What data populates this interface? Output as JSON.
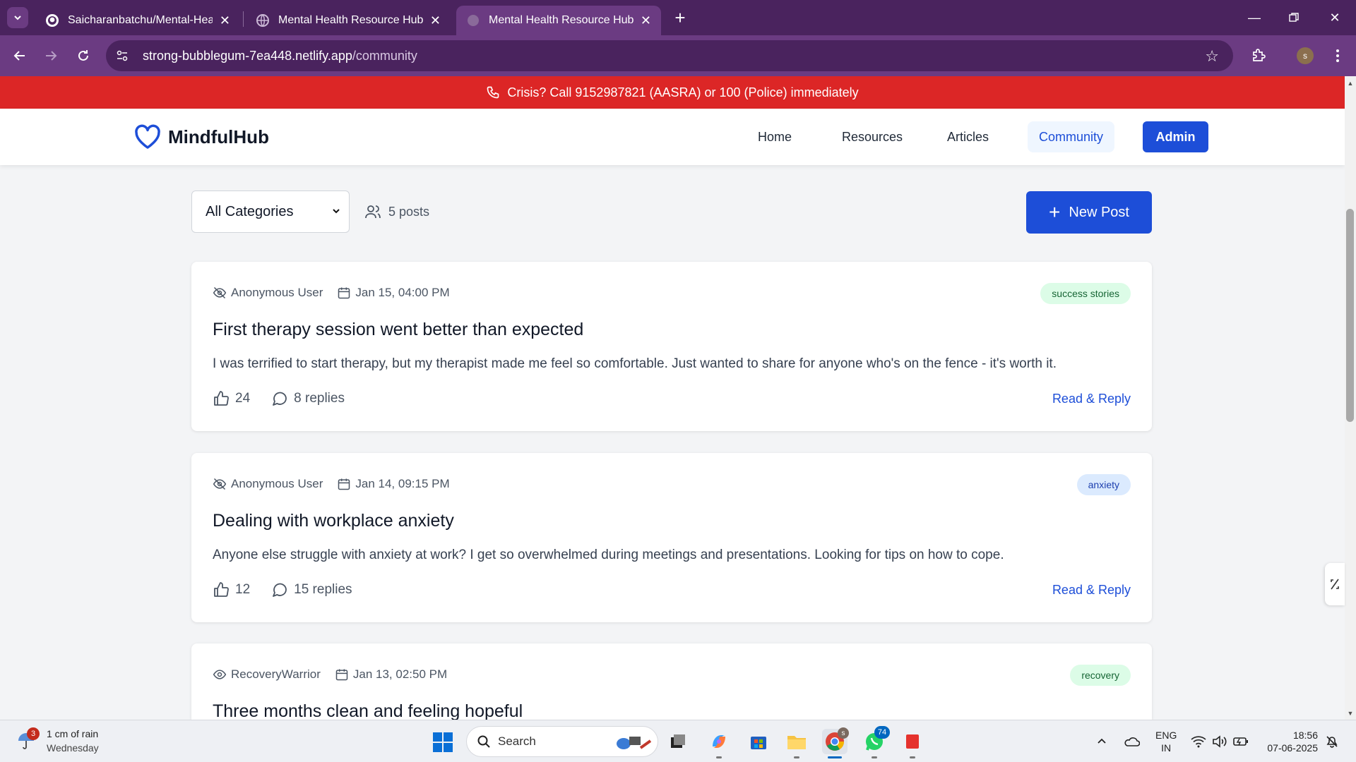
{
  "browser": {
    "tabs": [
      {
        "title": "Saicharanbatchu/Mental-Health"
      },
      {
        "title": "Mental Health Resource Hub - S"
      },
      {
        "title": "Mental Health Resource Hub - S"
      }
    ],
    "url_host": "strong-bubblegum-7ea448.netlify.app",
    "url_path": "/community",
    "profile_initial": "s"
  },
  "banner": {
    "text": "Crisis? Call 9152987821 (AASRA) or 100 (Police) immediately"
  },
  "header": {
    "brand": "MindfulHub",
    "nav": [
      "Home",
      "Resources",
      "Articles",
      "Community"
    ],
    "admin_label": "Admin"
  },
  "toolbar": {
    "category_selected": "All Categories",
    "post_count": "5 posts",
    "new_post_label": "New Post"
  },
  "posts": [
    {
      "author": "Anonymous User",
      "date": "Jan 15, 04:00 PM",
      "tag": "success stories",
      "title": "First therapy session went better than expected",
      "body": "I was terrified to start therapy, but my therapist made me feel so comfortable. Just wanted to share for anyone who's on the fence - it's worth it.",
      "likes": "24",
      "replies": "8 replies",
      "action": "Read & Reply"
    },
    {
      "author": "Anonymous User",
      "date": "Jan 14, 09:15 PM",
      "tag": "anxiety",
      "title": "Dealing with workplace anxiety",
      "body": "Anyone else struggle with anxiety at work? I get so overwhelmed during meetings and presentations. Looking for tips on how to cope.",
      "likes": "12",
      "replies": "15 replies",
      "action": "Read & Reply"
    },
    {
      "author": "RecoveryWarrior",
      "date": "Jan 13, 02:50 PM",
      "tag": "recovery",
      "title": "Three months clean and feeling hopeful"
    }
  ],
  "taskbar": {
    "weather_badge": "3",
    "weather_line1": "1 cm of rain",
    "weather_line2": "Wednesday",
    "search_placeholder": "Search",
    "chrome_badge": "s",
    "whatsapp_badge": "74",
    "lang_line1": "ENG",
    "lang_line2": "IN",
    "time": "18:56",
    "date": "07-06-2025"
  },
  "colors": {
    "accent": "#1d4ed8",
    "crisis": "#dc2626",
    "chrome_dark": "#4a235e",
    "chrome_light": "#6b3b82"
  }
}
